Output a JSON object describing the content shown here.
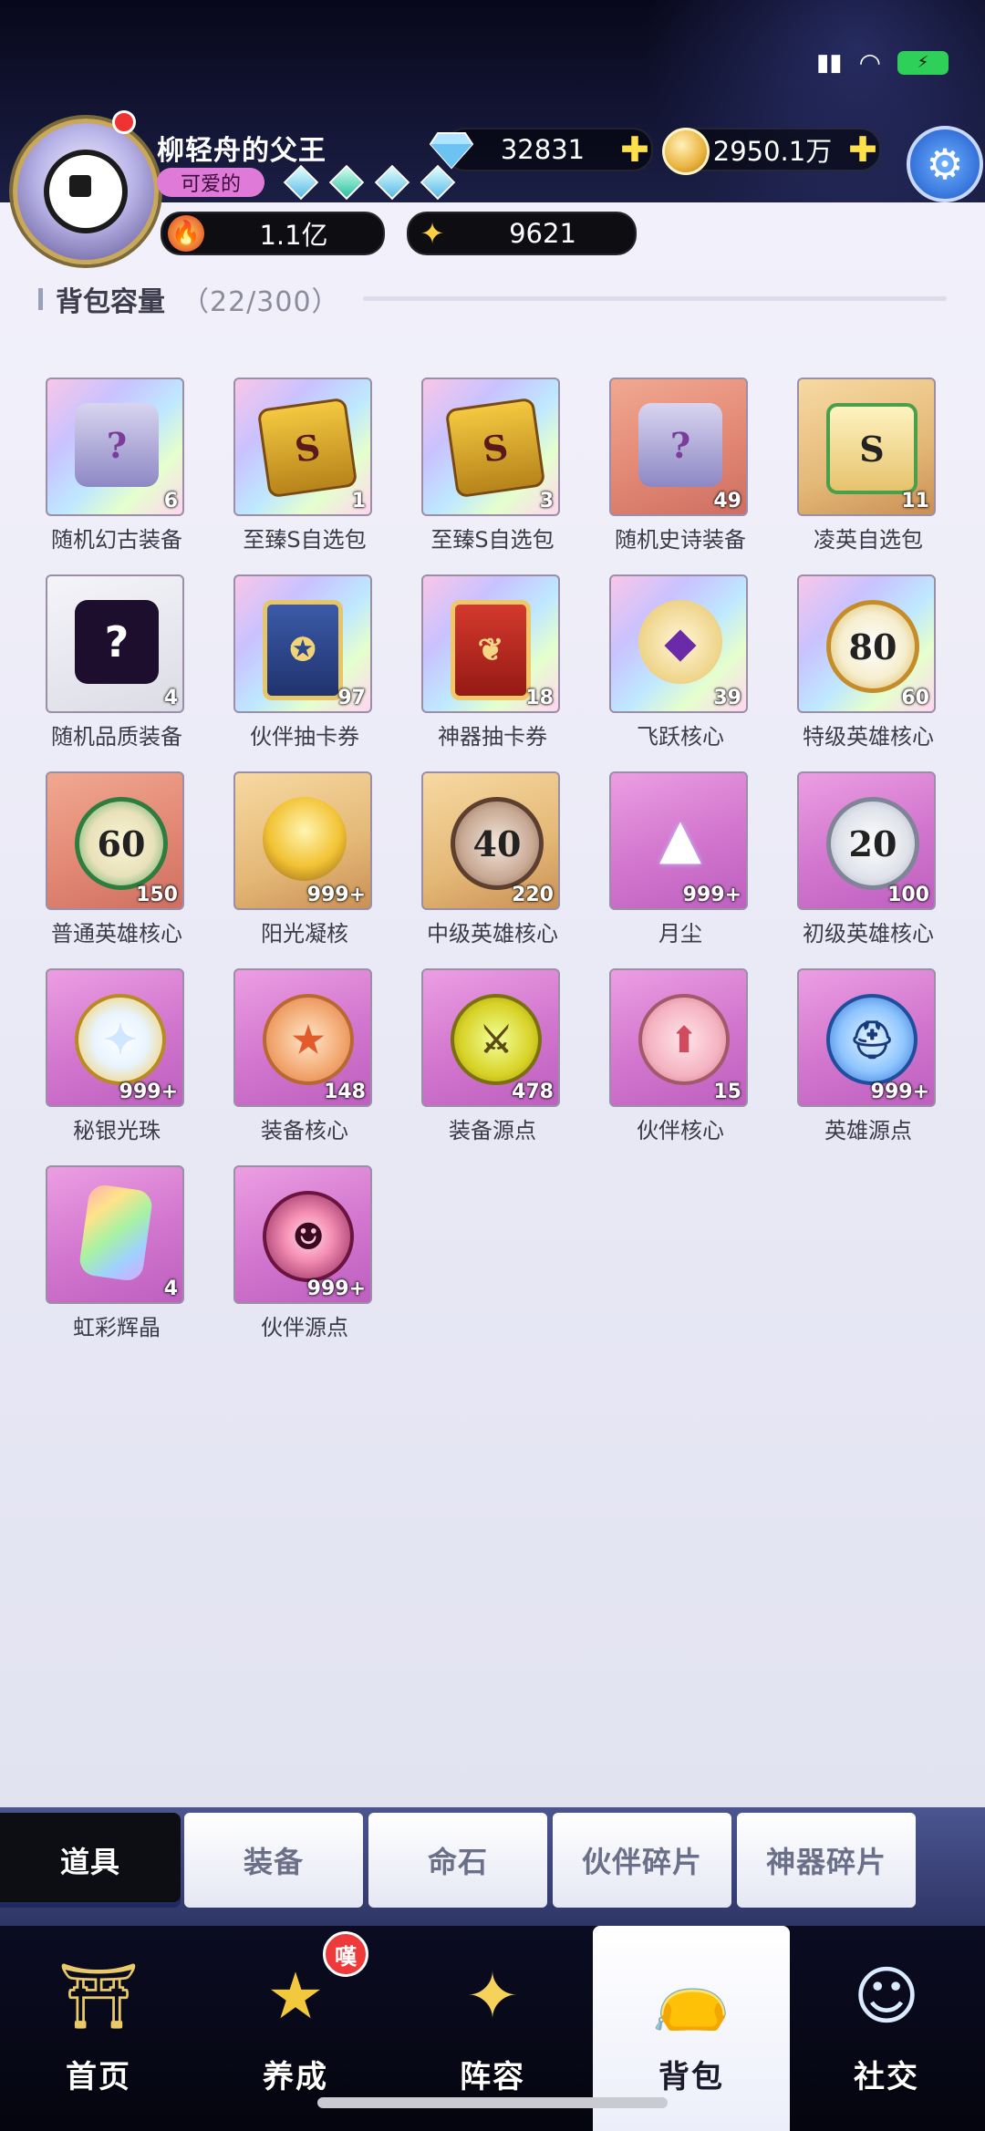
{
  "header": {
    "player_name": "柳轻舟的父王",
    "title_badge": "可爱的",
    "gems": "32831",
    "gold": "2950.1万",
    "power": "1.1亿",
    "stars": "9621",
    "plus": "✚"
  },
  "bag": {
    "capacity_label": "背包容量",
    "capacity_count": "（22/300）",
    "items": [
      {
        "name": "随机幻古装备",
        "qty": "6",
        "rarity": "r-rainbow",
        "icon": "ic-chest",
        "glyph": "?"
      },
      {
        "name": "至臻S自选包",
        "qty": "1",
        "rarity": "r-rainbow",
        "icon": "ic-card",
        "glyph": "S"
      },
      {
        "name": "至臻S自选包",
        "qty": "3",
        "rarity": "r-rainbow",
        "icon": "ic-card",
        "glyph": "S"
      },
      {
        "name": "随机史诗装备",
        "qty": "49",
        "rarity": "r-red",
        "icon": "ic-chest",
        "glyph": "?"
      },
      {
        "name": "凌英自选包",
        "qty": "11",
        "rarity": "r-gold",
        "icon": "ic-card-s",
        "glyph": "S"
      },
      {
        "name": "随机品质装备",
        "qty": "4",
        "rarity": "r-white",
        "icon": "ic-mystery",
        "glyph": "?"
      },
      {
        "name": "伙伴抽卡券",
        "qty": "97",
        "rarity": "r-rainbow",
        "icon": "ic-blue-card",
        "glyph": "✪"
      },
      {
        "name": "神器抽卡券",
        "qty": "18",
        "rarity": "r-rainbow",
        "icon": "ic-red-card",
        "glyph": "❦"
      },
      {
        "name": "飞跃核心",
        "qty": "39",
        "rarity": "r-rainbow",
        "icon": "ic-crystal",
        "glyph": "◆"
      },
      {
        "name": "特级英雄核心",
        "qty": "60",
        "rarity": "r-rainbow",
        "icon": "ic-medal",
        "glyph": "80"
      },
      {
        "name": "普通英雄核心",
        "qty": "150",
        "rarity": "r-red",
        "icon": "ic-green",
        "glyph": "60"
      },
      {
        "name": "阳光凝核",
        "qty": "999+",
        "rarity": "r-gold",
        "icon": "ic-sun",
        "glyph": ""
      },
      {
        "name": "中级英雄核心",
        "qty": "220",
        "rarity": "r-gold",
        "icon": "ic-bronze",
        "glyph": "40"
      },
      {
        "name": "月尘",
        "qty": "999+",
        "rarity": "r-purple",
        "icon": "ic-dust",
        "glyph": "▲"
      },
      {
        "name": "初级英雄核心",
        "qty": "100",
        "rarity": "r-purple",
        "icon": "ic-silver",
        "glyph": "20"
      },
      {
        "name": "秘银光珠",
        "qty": "999+",
        "rarity": "r-purple",
        "icon": "ic-pearl",
        "glyph": "✦"
      },
      {
        "name": "装备核心",
        "qty": "148",
        "rarity": "r-purple",
        "icon": "ic-orange",
        "glyph": "★"
      },
      {
        "name": "装备源点",
        "qty": "478",
        "rarity": "r-purple",
        "icon": "ic-yellow",
        "glyph": "⚔"
      },
      {
        "name": "伙伴核心",
        "qty": "15",
        "rarity": "r-purple",
        "icon": "ic-pink",
        "glyph": "⬆"
      },
      {
        "name": "英雄源点",
        "qty": "999+",
        "rarity": "r-purple",
        "icon": "ic-blue",
        "glyph": "⛑"
      },
      {
        "name": "虹彩辉晶",
        "qty": "4",
        "rarity": "r-purple",
        "icon": "ic-prism",
        "glyph": ""
      },
      {
        "name": "伙伴源点",
        "qty": "999+",
        "rarity": "r-purple",
        "icon": "ic-magenta",
        "glyph": "☻"
      }
    ]
  },
  "subtabs": [
    "道具",
    "装备",
    "命石",
    "伙伴碎片",
    "神器碎片"
  ],
  "nav": {
    "items": [
      {
        "label": "首页",
        "icon": "home-icon",
        "glyph": "⛩"
      },
      {
        "label": "养成",
        "icon": "star-icon",
        "glyph": "★"
      },
      {
        "label": "阵容",
        "icon": "lineup-icon",
        "glyph": "✦"
      },
      {
        "label": "背包",
        "icon": "bag-icon",
        "glyph": "👝"
      },
      {
        "label": "社交",
        "icon": "social-icon",
        "glyph": "☺"
      }
    ],
    "badge": "嘆"
  }
}
